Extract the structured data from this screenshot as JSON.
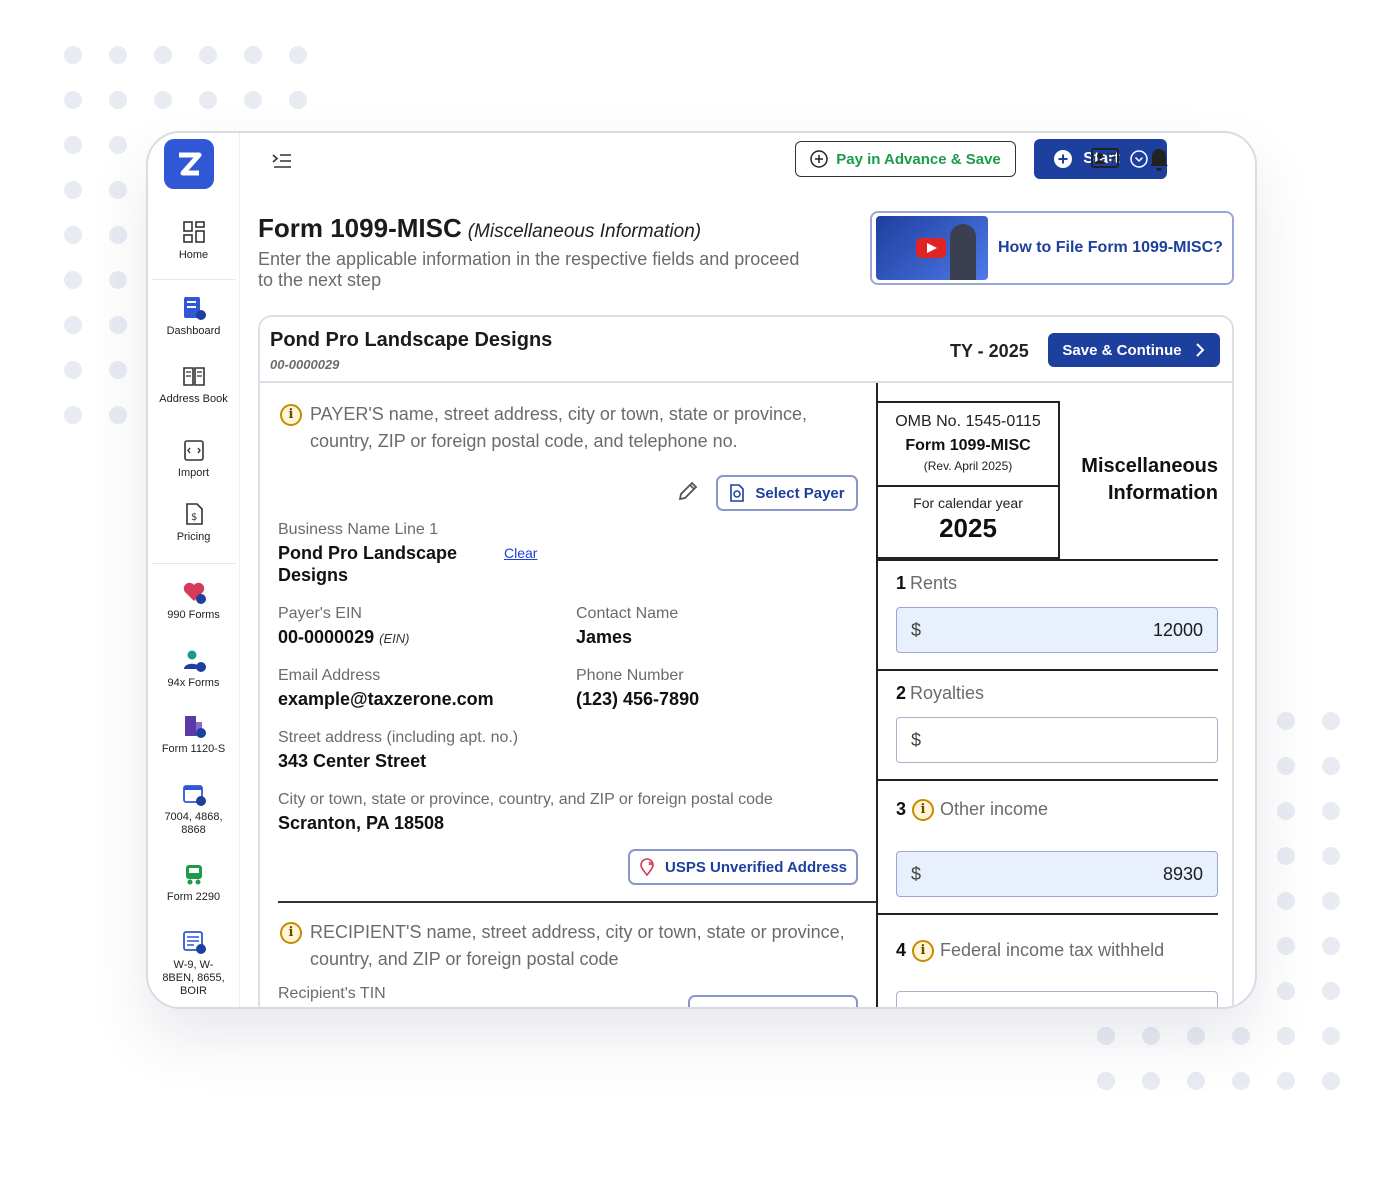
{
  "nav": {
    "home": "Home",
    "dashboard": "Dashboard",
    "address_book": "Address Book",
    "import": "Import",
    "pricing": "Pricing",
    "forms_990": "990 Forms",
    "forms_94x": "94x Forms",
    "form_1120s": "Form 1120-S",
    "forms_7004": "7004, 4868, 8868",
    "form_2290": "Form 2290",
    "w9": "W-9, W-8BEN, 8655, BOIR"
  },
  "topbar": {
    "pay_advance": "Pay in Advance & Save",
    "start": "Start",
    "notification_count": "21"
  },
  "page": {
    "title": "Form 1099-MISC",
    "title_note": "(Miscellaneous Information)",
    "subtitle": "Enter the applicable information in the respective fields and proceed to the next step",
    "video_label": "How to File Form 1099-MISC?"
  },
  "card": {
    "payer_name": "Pond Pro Landscape Designs",
    "payer_id": "00-0000029",
    "tax_year": "TY - 2025",
    "save_continue": "Save & Continue"
  },
  "payer_section": {
    "heading": "PAYER'S name, street address, city or town, state or province, country, ZIP or foreign postal code, and telephone no.",
    "select_payer": "Select Payer",
    "business_name_label": "Business Name Line 1",
    "business_name_line1": "Pond Pro Landscape",
    "business_name_line2": "Designs",
    "clear": "Clear",
    "ein_label": "Payer's EIN",
    "ein_value": "00-0000029",
    "ein_suffix": "(EIN)",
    "contact_label": "Contact Name",
    "contact_value": "James",
    "email_label": "Email Address",
    "email_value": "example@taxzerone.com",
    "phone_label": "Phone Number",
    "phone_value": "(123) 456-7890",
    "street_label": "Street address (including apt. no.)",
    "street_value": "343 Center Street",
    "city_label": "City or town, state or province, country, and ZIP or foreign postal code",
    "city_value": "Scranton, PA 18508",
    "usps": "USPS Unverified Address"
  },
  "recipient_section": {
    "heading": "RECIPIENT'S name, street address, city or town, state or province, country, and ZIP or foreign postal code",
    "tin_label": "Recipient's TIN"
  },
  "form_box": {
    "omb": "OMB No. 1545-0115",
    "form_name": "Form 1099-MISC",
    "rev": "(Rev. April 2025)",
    "calendar_label": "For calendar year",
    "year": "2025",
    "misc_line1": "Miscellaneous",
    "misc_line2": "Information",
    "box1_num": "1",
    "box1_label": "Rents",
    "box1_value": "12000",
    "box2_num": "2",
    "box2_label": "Royalties",
    "box2_value": "",
    "box3_num": "3",
    "box3_label": "Other income",
    "box3_value": "8930",
    "box4_num": "4",
    "box4_label": "Federal income tax withheld",
    "currency": "$"
  },
  "colors": {
    "primary": "#1d3f9e",
    "logo": "#2f57d6",
    "advance_text": "#1c9b4b",
    "badge": "#e02424",
    "info": "#c78a00"
  }
}
